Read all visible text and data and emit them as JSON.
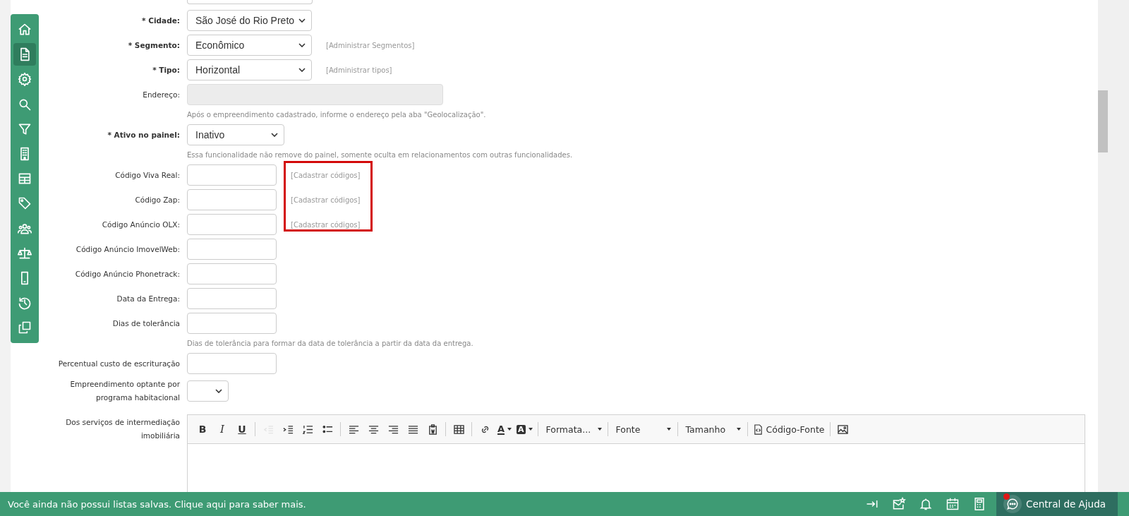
{
  "sidebar": {
    "items": [
      {
        "kind": "home",
        "selected": false
      },
      {
        "kind": "document",
        "selected": true
      },
      {
        "kind": "gear",
        "selected": false
      },
      {
        "kind": "search",
        "selected": false
      },
      {
        "kind": "filter",
        "selected": false
      },
      {
        "kind": "building",
        "selected": false
      },
      {
        "kind": "table",
        "selected": false
      },
      {
        "kind": "tag",
        "selected": false
      },
      {
        "kind": "users",
        "selected": false
      },
      {
        "kind": "scale",
        "selected": false
      },
      {
        "kind": "phone",
        "selected": false
      },
      {
        "kind": "history",
        "selected": false
      },
      {
        "kind": "copy",
        "selected": false
      }
    ]
  },
  "form": {
    "fields": [
      {
        "label": "* Cidade:",
        "required": true,
        "kind": "select-wide",
        "value": "São José do Rio Preto"
      },
      {
        "label": "* Segmento:",
        "required": true,
        "kind": "select-wide",
        "value": "Econômico",
        "link": "[Administrar Segmentos]"
      },
      {
        "label": "* Tipo:",
        "required": true,
        "kind": "select-wide",
        "value": "Horizontal",
        "link": "[Administrar tipos]"
      },
      {
        "label": "Endereço:",
        "required": false,
        "kind": "address",
        "disabled": true,
        "hint": "Após o empreendimento cadastrado, informe o endereço pela aba \"Geolocalização\"."
      },
      {
        "label": "* Ativo no painel:",
        "required": true,
        "kind": "select",
        "value": "Inativo",
        "hint": "Essa funcionalidade não remove do painel, somente oculta em relacionamentos com outras funcionalidades."
      },
      {
        "label": "Código Viva Real:",
        "required": false,
        "kind": "text",
        "link": "[Cadastrar códigos]"
      },
      {
        "label": "Código Zap:",
        "required": false,
        "kind": "text",
        "link": "[Cadastrar códigos]"
      },
      {
        "label": "Código Anúncio OLX:",
        "required": false,
        "kind": "text",
        "link": "[Cadastrar códigos]"
      },
      {
        "label": "Código Anúncio ImovelWeb:",
        "required": false,
        "kind": "text"
      },
      {
        "label": "Código Anúncio Phonetrack:",
        "required": false,
        "kind": "text"
      },
      {
        "label": "Data da Entrega:",
        "required": false,
        "kind": "text"
      },
      {
        "label": "Dias de tolerância",
        "required": false,
        "kind": "text",
        "hint": "Dias de tolerância para formar da data de tolerância a partir da data da entrega."
      },
      {
        "label": "Percentual custo de escrituração",
        "required": false,
        "kind": "text"
      },
      {
        "label": "Empreendimento optante por programa habitacional",
        "required": false,
        "kind": "select-compact"
      }
    ],
    "editor": {
      "label": "Dos serviços de intermediação imobiliária",
      "toolbar": [
        [
          {
            "kind": "bold",
            "text": "B",
            "disabled": false
          },
          {
            "kind": "italic",
            "text": "I",
            "disabled": false
          },
          {
            "kind": "underline",
            "text": "U",
            "disabled": false
          }
        ],
        [
          {
            "kind": "outdent",
            "disabled": true
          },
          {
            "kind": "indent",
            "disabled": false
          },
          {
            "kind": "numbered-list",
            "disabled": false
          },
          {
            "kind": "bulleted-list",
            "disabled": false
          }
        ],
        [
          {
            "kind": "align-left",
            "disabled": false
          },
          {
            "kind": "align-center",
            "disabled": false
          },
          {
            "kind": "align-right",
            "disabled": false
          },
          {
            "kind": "justify",
            "disabled": false
          },
          {
            "kind": "paste-word",
            "disabled": false
          }
        ],
        [
          {
            "kind": "table",
            "disabled": false
          }
        ],
        [
          {
            "kind": "link",
            "disabled": false
          },
          {
            "kind": "text-color",
            "text": "A",
            "disabled": false
          },
          {
            "kind": "background-color",
            "text": "A",
            "disabled": false
          }
        ],
        [
          {
            "kind": "dropdown",
            "text": "Formata...",
            "disabled": false
          }
        ],
        [
          {
            "kind": "dropdown",
            "text": "Fonte",
            "disabled": false
          }
        ],
        [
          {
            "kind": "dropdown",
            "text": "Tamanho",
            "disabled": false
          }
        ],
        [
          {
            "kind": "source",
            "text": "Código-Fonte",
            "disabled": false
          }
        ],
        [
          {
            "kind": "image",
            "disabled": false
          }
        ]
      ]
    }
  },
  "bottom_bar": {
    "message": "Você ainda não possui listas salvas. Clique aqui para saber mais.",
    "help": {
      "label": "Central de Ajuda",
      "notification": true
    }
  }
}
